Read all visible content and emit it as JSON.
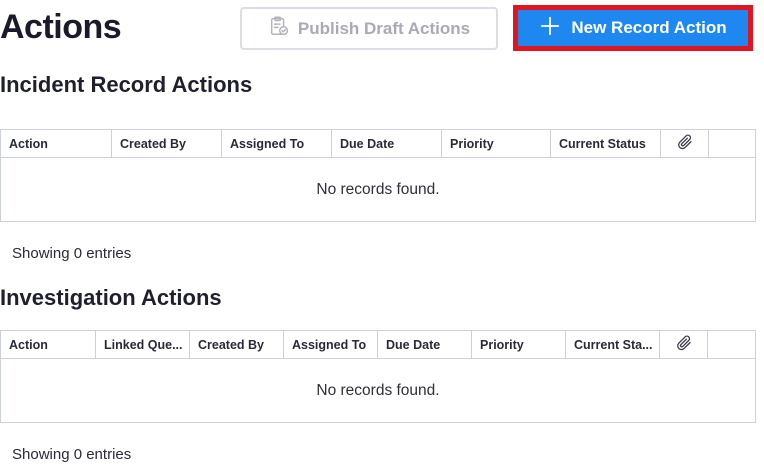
{
  "page": {
    "title": "Actions"
  },
  "toolbar": {
    "publish_label": "Publish Draft Actions",
    "new_label": "New Record Action"
  },
  "incident": {
    "title": "Incident Record Actions",
    "columns": [
      "Action",
      "Created By",
      "Assigned To",
      "Due Date",
      "Priority",
      "Current Status"
    ],
    "empty_text": "No records found.",
    "entries_text": "Showing 0 entries"
  },
  "investigation": {
    "title": "Investigation Actions",
    "columns": [
      "Action",
      "Linked Que...",
      "Created By",
      "Assigned To",
      "Due Date",
      "Priority",
      "Current Sta..."
    ],
    "empty_text": "No records found.",
    "entries_text": "Showing 0 entries"
  },
  "colors": {
    "primary": "#1e88f0",
    "highlight": "#e0151f",
    "disabled_text": "#a9aab4",
    "border": "#cfd1d8"
  },
  "icons": {
    "publish": "clipboard-check-icon",
    "new": "plus-icon",
    "attachment": "paperclip-icon"
  }
}
